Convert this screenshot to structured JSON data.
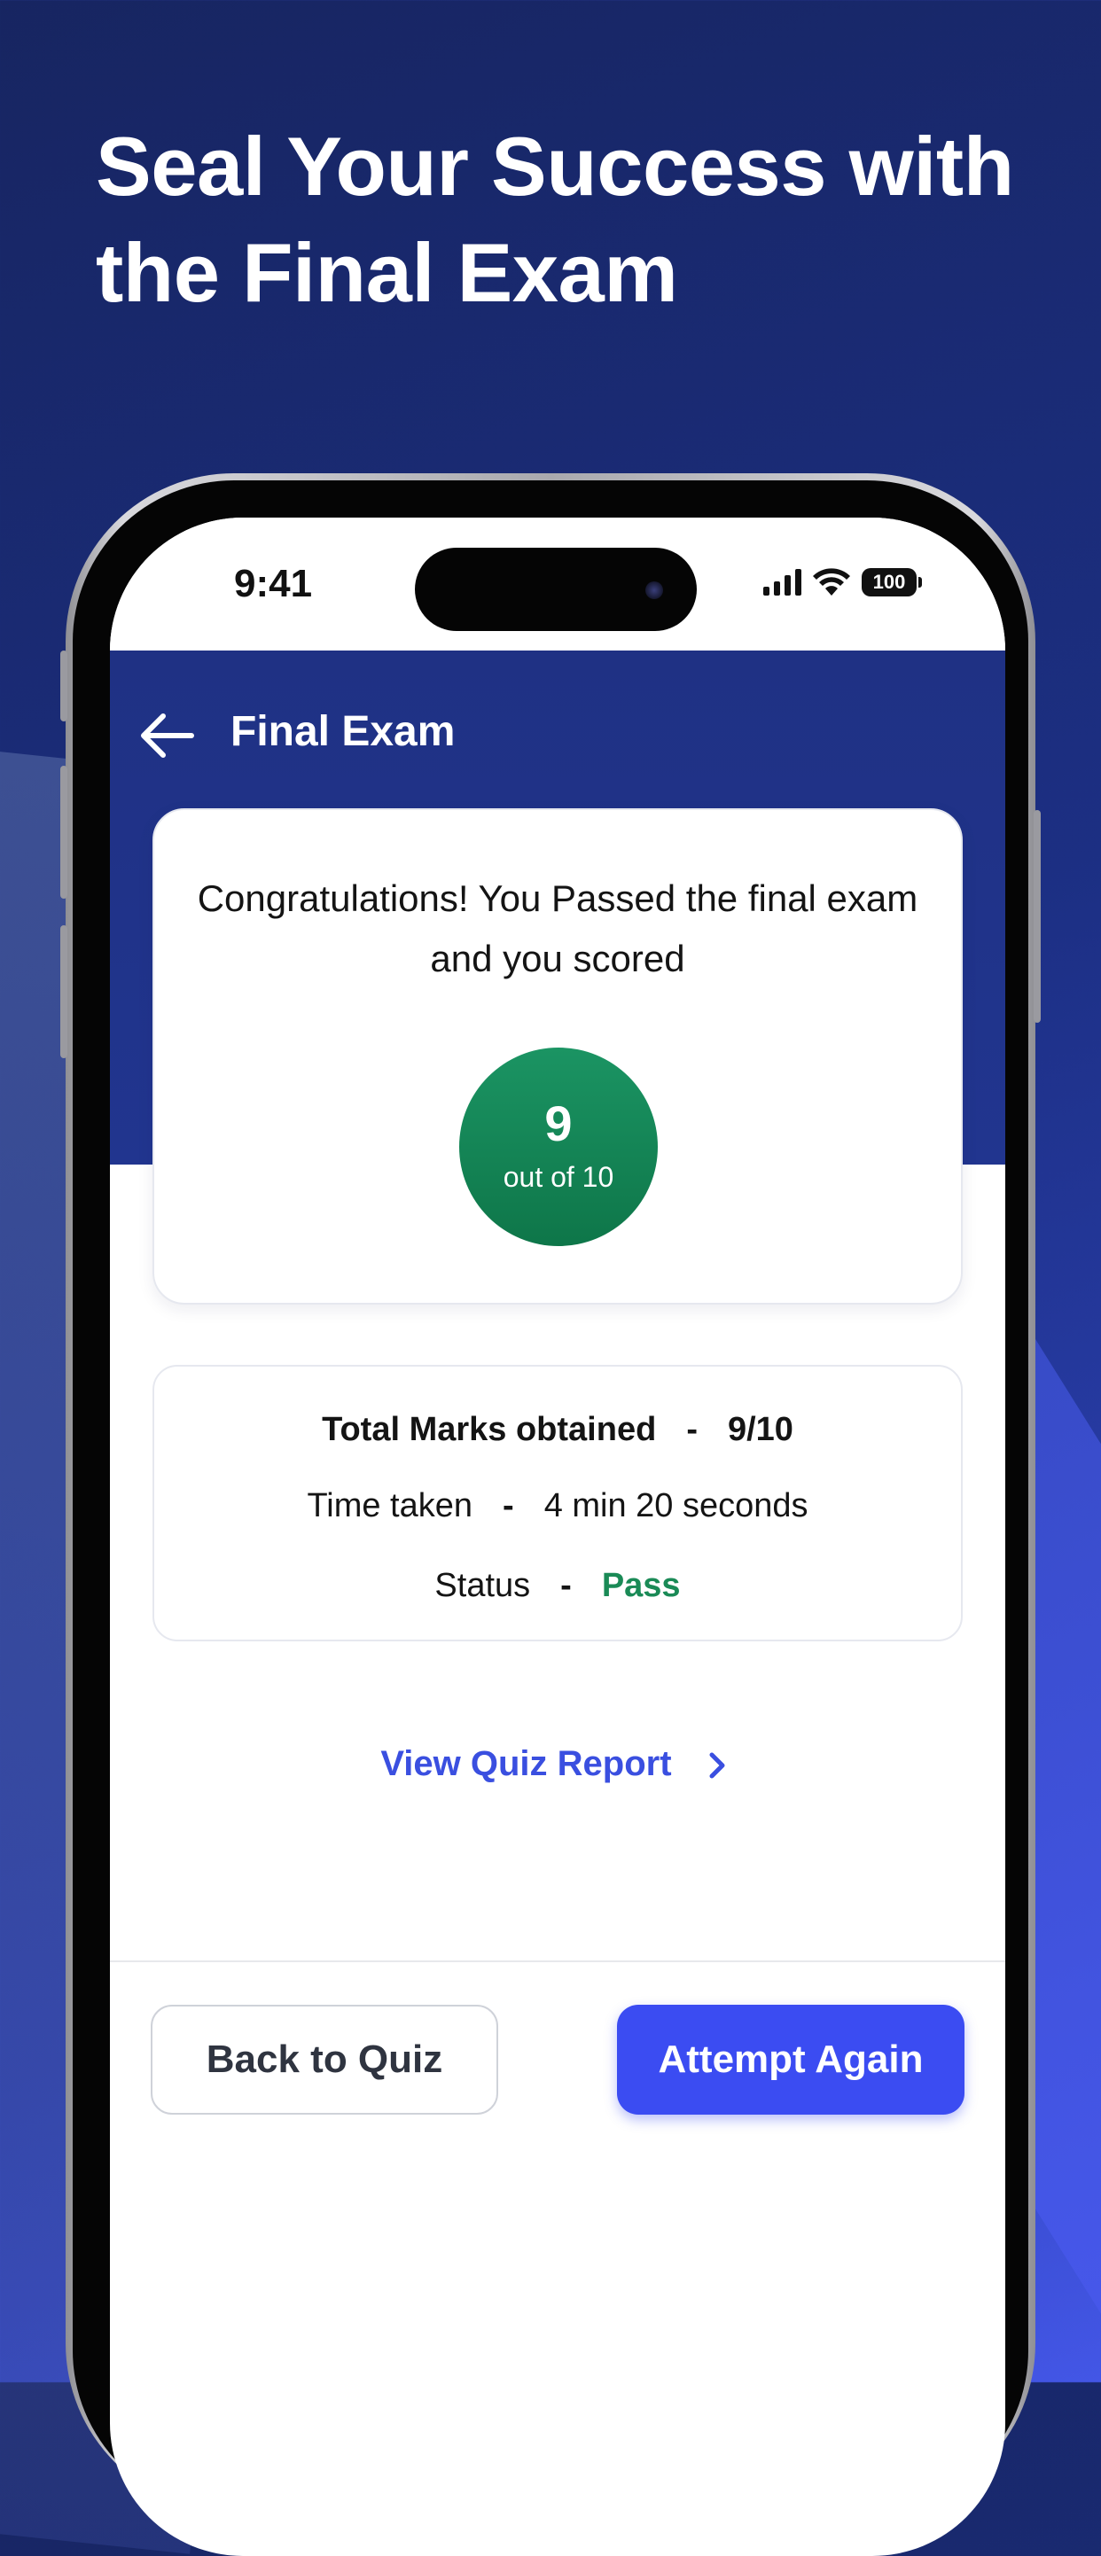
{
  "promo": {
    "headline_line1": "Seal Your Success with",
    "headline_line2": "the Final Exam"
  },
  "status_bar": {
    "time": "9:41",
    "battery": "100"
  },
  "header": {
    "title": "Final Exam"
  },
  "result": {
    "message": "Congratulations! You Passed the final exam and you scored",
    "score": "9",
    "score_caption": "out of 10"
  },
  "summary": {
    "marks_label": "Total Marks obtained",
    "marks_value": "9/10",
    "time_label": "Time taken",
    "time_value": "4 min 20 seconds",
    "status_label": "Status",
    "status_value": "Pass",
    "separator": "-"
  },
  "actions": {
    "report_link": "View Quiz Report",
    "back_button": "Back to Quiz",
    "attempt_button": "Attempt Again"
  },
  "colors": {
    "primary": "#3b4cf2",
    "header": "#1f3184",
    "success": "#1a8a56"
  }
}
